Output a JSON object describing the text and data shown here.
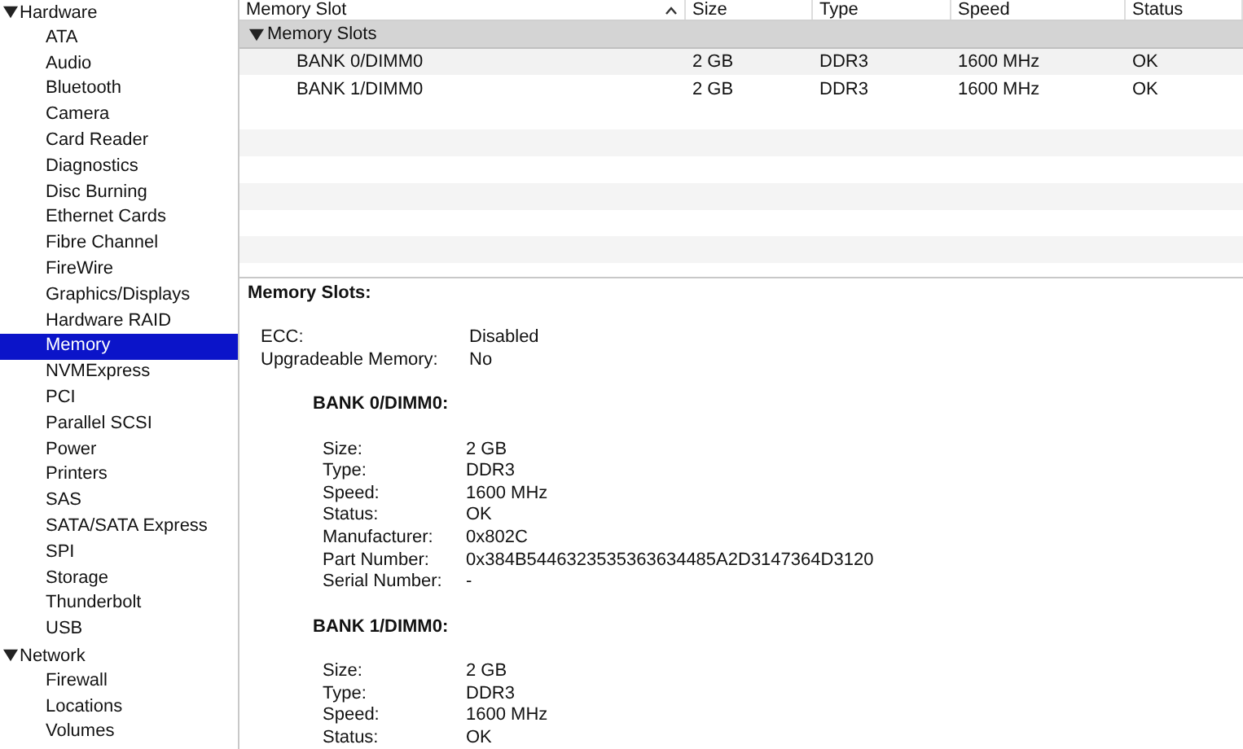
{
  "sidebar": {
    "groups": [
      {
        "label": "Hardware",
        "expanded": true,
        "children": [
          {
            "label": "ATA",
            "selected": false
          },
          {
            "label": "Audio",
            "selected": false
          },
          {
            "label": "Bluetooth",
            "selected": false
          },
          {
            "label": "Camera",
            "selected": false
          },
          {
            "label": "Card Reader",
            "selected": false
          },
          {
            "label": "Diagnostics",
            "selected": false
          },
          {
            "label": "Disc Burning",
            "selected": false
          },
          {
            "label": "Ethernet Cards",
            "selected": false
          },
          {
            "label": "Fibre Channel",
            "selected": false
          },
          {
            "label": "FireWire",
            "selected": false
          },
          {
            "label": "Graphics/Displays",
            "selected": false
          },
          {
            "label": "Hardware RAID",
            "selected": false
          },
          {
            "label": "Memory",
            "selected": true
          },
          {
            "label": "NVMExpress",
            "selected": false
          },
          {
            "label": "PCI",
            "selected": false
          },
          {
            "label": "Parallel SCSI",
            "selected": false
          },
          {
            "label": "Power",
            "selected": false
          },
          {
            "label": "Printers",
            "selected": false
          },
          {
            "label": "SAS",
            "selected": false
          },
          {
            "label": "SATA/SATA Express",
            "selected": false
          },
          {
            "label": "SPI",
            "selected": false
          },
          {
            "label": "Storage",
            "selected": false
          },
          {
            "label": "Thunderbolt",
            "selected": false
          },
          {
            "label": "USB",
            "selected": false
          }
        ]
      },
      {
        "label": "Network",
        "expanded": true,
        "children": [
          {
            "label": "Firewall",
            "selected": false
          },
          {
            "label": "Locations",
            "selected": false
          },
          {
            "label": "Volumes",
            "selected": false
          }
        ]
      }
    ]
  },
  "table": {
    "columns": [
      {
        "label": "Memory Slot",
        "sorted": true
      },
      {
        "label": "Size",
        "sorted": false
      },
      {
        "label": "Type",
        "sorted": false
      },
      {
        "label": "Speed",
        "sorted": false
      },
      {
        "label": "Status",
        "sorted": false
      }
    ],
    "groups": [
      {
        "label": "Memory Slots",
        "expanded": true,
        "rows": [
          [
            "BANK 0/DIMM0",
            "2 GB",
            "DDR3",
            "1600 MHz",
            "OK"
          ],
          [
            "BANK 1/DIMM0",
            "2 GB",
            "DDR3",
            "1600 MHz",
            "OK"
          ]
        ]
      }
    ]
  },
  "detail": {
    "title": "Memory Slots:",
    "fields": [
      {
        "label": "ECC:",
        "value": "Disabled"
      },
      {
        "label": "Upgradeable Memory:",
        "value": "No"
      }
    ],
    "banks": [
      {
        "title": "BANK 0/DIMM0:",
        "fields": [
          {
            "label": "Size:",
            "value": "2 GB"
          },
          {
            "label": "Type:",
            "value": "DDR3"
          },
          {
            "label": "Speed:",
            "value": "1600 MHz"
          },
          {
            "label": "Status:",
            "value": "OK"
          },
          {
            "label": "Manufacturer:",
            "value": "0x802C"
          },
          {
            "label": "Part Number:",
            "value": "0x384B5446323535363634485A2D3147364D3120"
          },
          {
            "label": "Serial Number:",
            "value": "-"
          }
        ]
      },
      {
        "title": "BANK 1/DIMM0:",
        "fields": [
          {
            "label": "Size:",
            "value": "2 GB"
          },
          {
            "label": "Type:",
            "value": "DDR3"
          },
          {
            "label": "Speed:",
            "value": "1600 MHz"
          },
          {
            "label": "Status:",
            "value": "OK"
          }
        ]
      }
    ]
  }
}
